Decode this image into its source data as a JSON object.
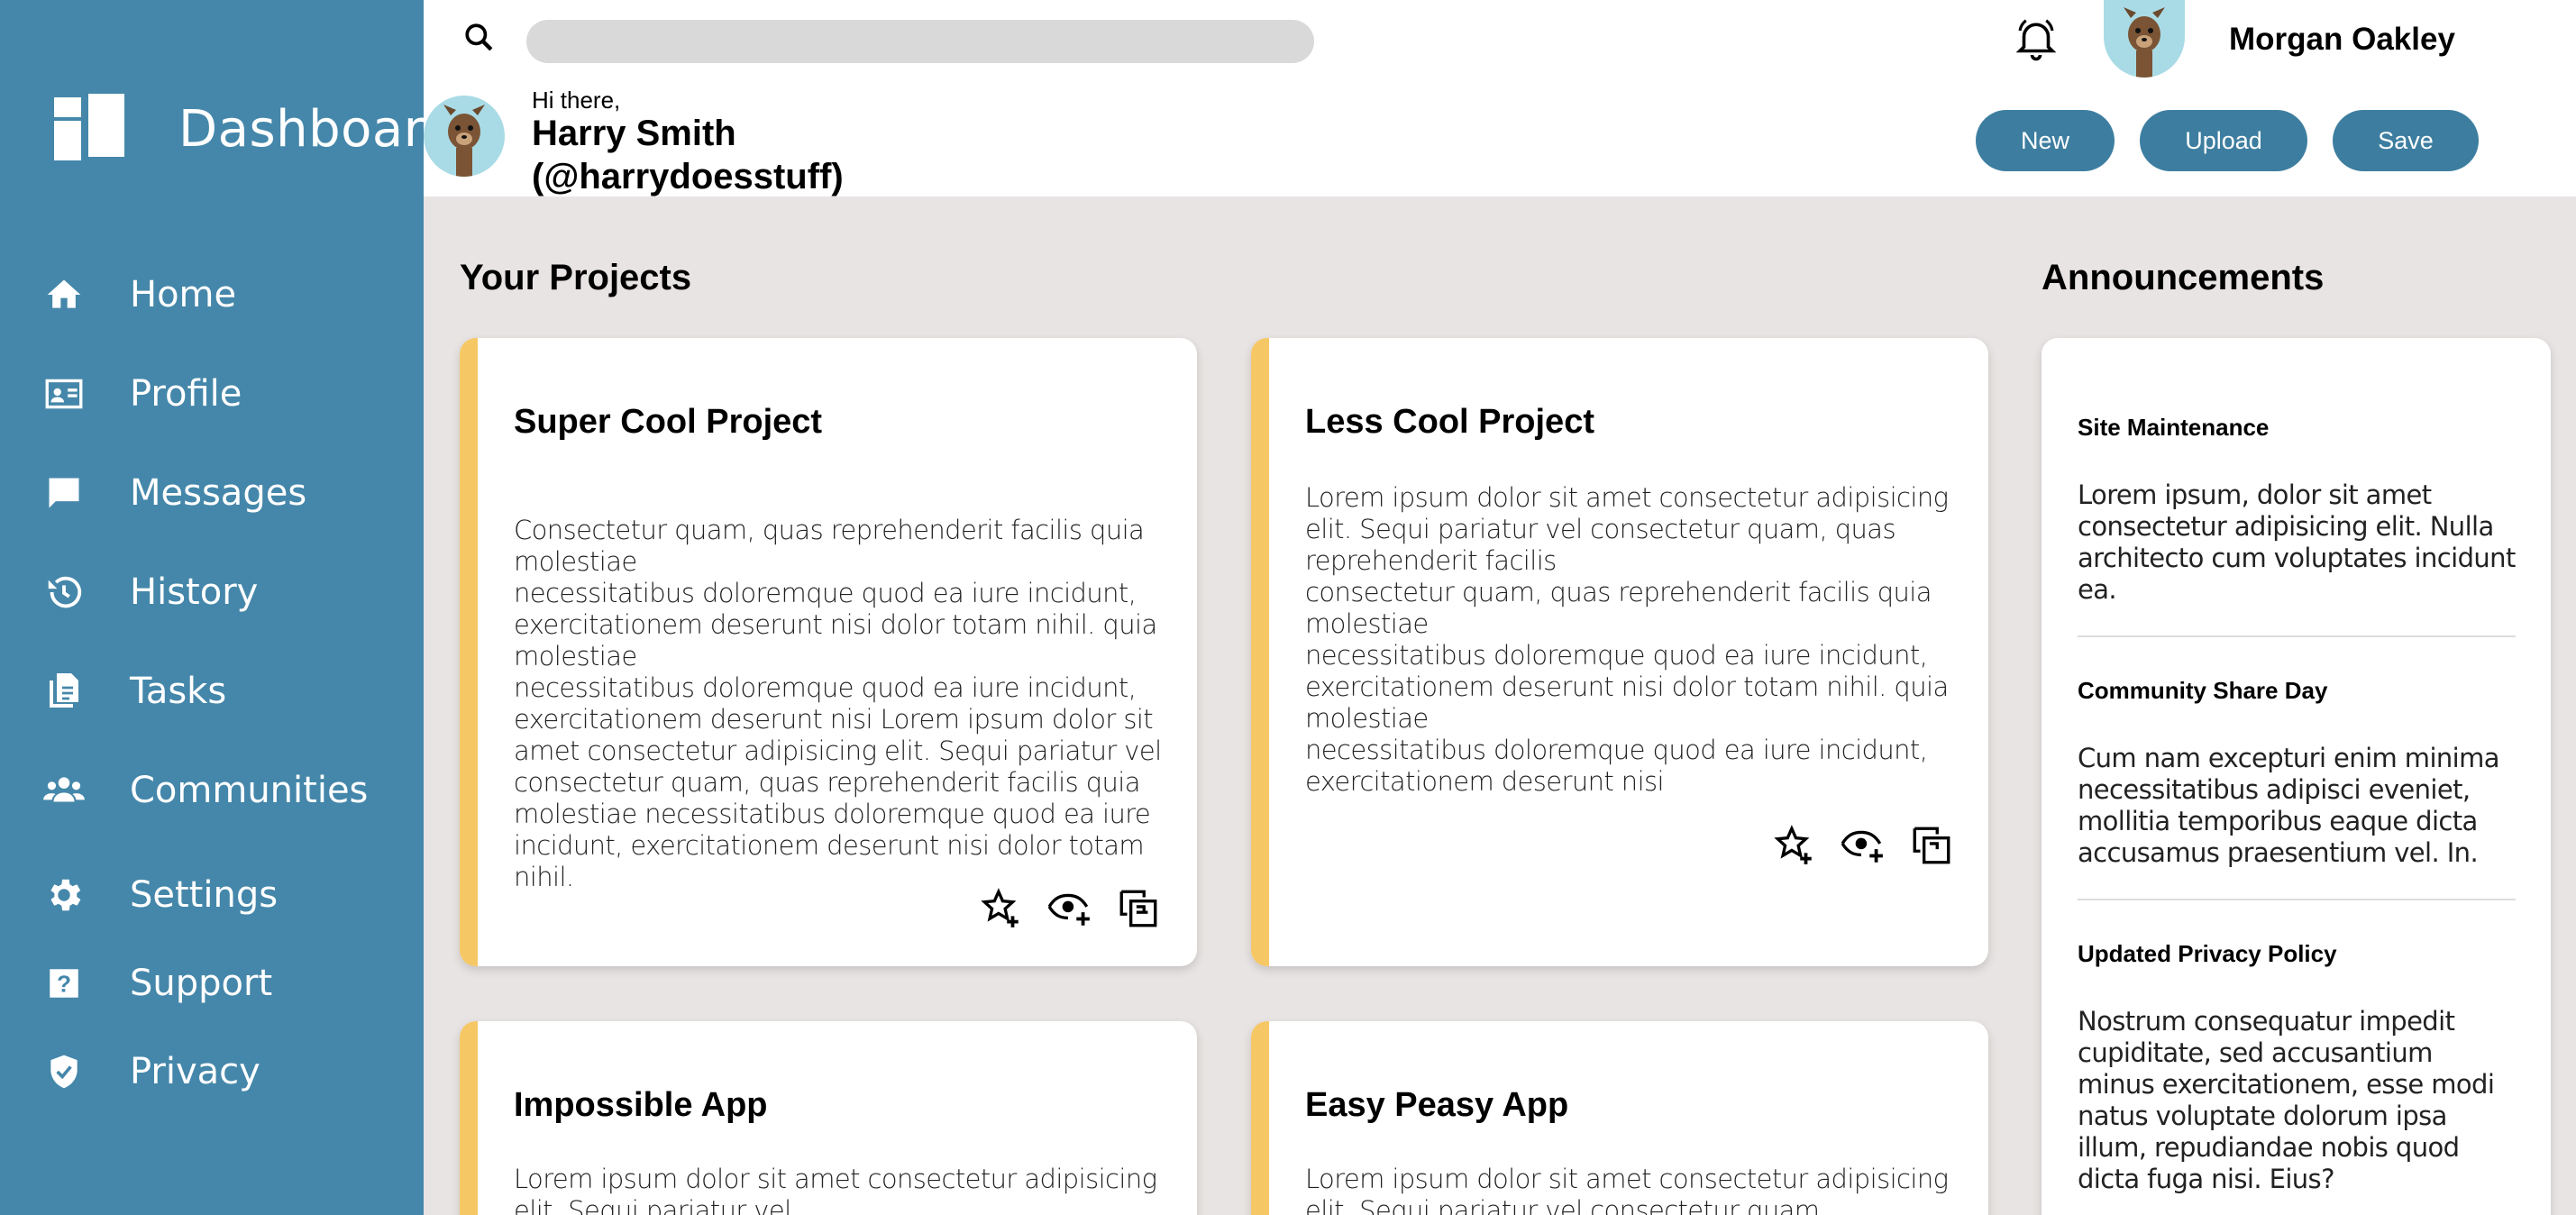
{
  "sidebar": {
    "brand": "Dashboard",
    "items": [
      {
        "label": "Home",
        "icon": "home-icon"
      },
      {
        "label": "Profile",
        "icon": "profile-card-icon"
      },
      {
        "label": "Messages",
        "icon": "message-icon"
      },
      {
        "label": "History",
        "icon": "history-icon"
      },
      {
        "label": "Tasks",
        "icon": "tasks-icon"
      },
      {
        "label": "Communities",
        "icon": "communities-icon"
      },
      {
        "label": "Settings",
        "icon": "gear-icon"
      },
      {
        "label": "Support",
        "icon": "help-icon"
      },
      {
        "label": "Privacy",
        "icon": "shield-icon"
      }
    ]
  },
  "header": {
    "search_placeholder": "",
    "user_name": "Morgan Oakley",
    "greeting": "Hi there,",
    "greeting_name": "Harry Smith (@harrydoesstuff)",
    "buttons": {
      "new": "New",
      "upload": "Upload",
      "save": "Save"
    }
  },
  "projects": {
    "title": "Your Projects",
    "cards": [
      {
        "title": "Super Cool Project",
        "body": "Consectetur quam, quas reprehenderit facilis quia molestiae\nnecessitatibus doloremque quod ea iure incidunt, exercitationem deserunt nisi dolor totam nihil. quia molestiae\nnecessitatibus doloremque quod ea iure incidunt, exercitationem deserunt nisi Lorem ipsum dolor sit amet consectetur adipisicing elit. Sequi pariatur vel consectetur quam, quas reprehenderit facilis quia molestiae necessitatibus doloremque quod ea iure incidunt, exercitationem deserunt nisi dolor totam nihil."
      },
      {
        "title": "Less Cool Project",
        "body": "Lorem ipsum dolor sit amet consectetur adipisicing elit. Sequi pariatur vel consectetur quam, quas reprehenderit facilis\nconsectetur quam, quas reprehenderit facilis quia molestiae\nnecessitatibus doloremque quod ea iure incidunt, exercitationem deserunt nisi dolor totam nihil. quia molestiae\nnecessitatibus doloremque quod ea iure incidunt, exercitationem deserunt nisi"
      },
      {
        "title": "Impossible App",
        "body": "Lorem ipsum dolor sit amet consectetur adipisicing elit. Sequi pariatur vel"
      },
      {
        "title": "Easy Peasy App",
        "body": "Lorem ipsum dolor sit amet consectetur adipisicing elit. Sequi pariatur vel consectetur quam"
      }
    ]
  },
  "announcements": {
    "title": "Announcements",
    "items": [
      {
        "title": "Site Maintenance",
        "text": "Lorem ipsum, dolor sit amet consectetur adipisicing elit. Nulla architecto cum voluptates incidunt ea."
      },
      {
        "title": "Community Share Day",
        "text": "Cum nam excepturi enim minima necessitatibus adipisci eveniet, mollitia temporibus eaque dicta accusamus praesentium vel. In."
      },
      {
        "title": "Updated Privacy Policy",
        "text": "Nostrum consequatur impedit cupiditate, sed accusantium minus exercitationem, esse modi natus voluptate dolorum ipsa illum, repudiandae nobis quod dicta fuga nisi. Eius?"
      }
    ]
  },
  "colors": {
    "sidebar": "#4587aa",
    "button": "#3d7ea0",
    "accent": "#f6c765",
    "background": "#e8e4e3"
  }
}
